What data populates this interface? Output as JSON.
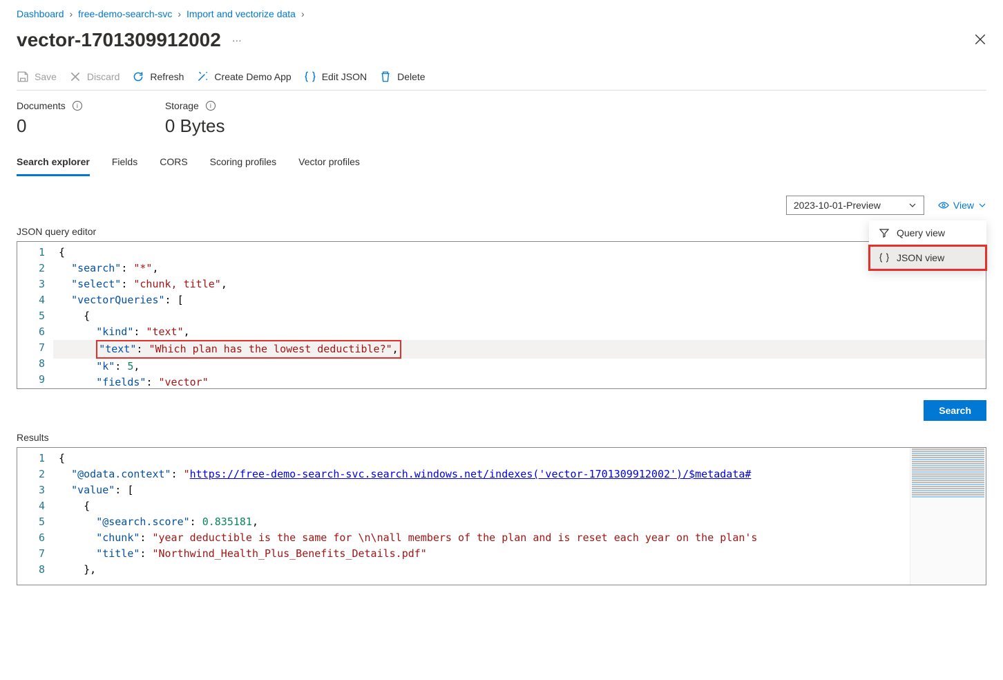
{
  "breadcrumb": [
    {
      "label": "Dashboard"
    },
    {
      "label": "free-demo-search-svc"
    },
    {
      "label": "Import and vectorize data"
    }
  ],
  "page_title": "vector-1701309912002",
  "toolbar": {
    "save": "Save",
    "discard": "Discard",
    "refresh": "Refresh",
    "create_demo": "Create Demo App",
    "edit_json": "Edit JSON",
    "delete": "Delete"
  },
  "stats": {
    "documents_label": "Documents",
    "documents_value": "0",
    "storage_label": "Storage",
    "storage_value": "0 Bytes"
  },
  "tabs": [
    {
      "label": "Search explorer",
      "active": true
    },
    {
      "label": "Fields"
    },
    {
      "label": "CORS"
    },
    {
      "label": "Scoring profiles"
    },
    {
      "label": "Vector profiles"
    }
  ],
  "api_version": "2023-10-01-Preview",
  "view_label": "View",
  "view_menu": {
    "query_view": "Query view",
    "json_view": "JSON view"
  },
  "editor_label": "JSON query editor",
  "query_json": {
    "search": "*",
    "select": "chunk, title",
    "vectorQueries": [
      {
        "kind": "text",
        "text": "Which plan has the lowest deductible?",
        "k": 5,
        "fields": "vector"
      }
    ]
  },
  "search_button": "Search",
  "results_label": "Results",
  "results_json": {
    "@odata.context": "https://free-demo-search-svc.search.windows.net/indexes('vector-1701309912002')/$metadata#",
    "value": [
      {
        "@search.score": 0.835181,
        "chunk": "year deductible is the same for \\n\\nall members of the plan and is reset each year on the plan's",
        "title": "Northwind_Health_Plus_Benefits_Details.pdf"
      }
    ]
  }
}
